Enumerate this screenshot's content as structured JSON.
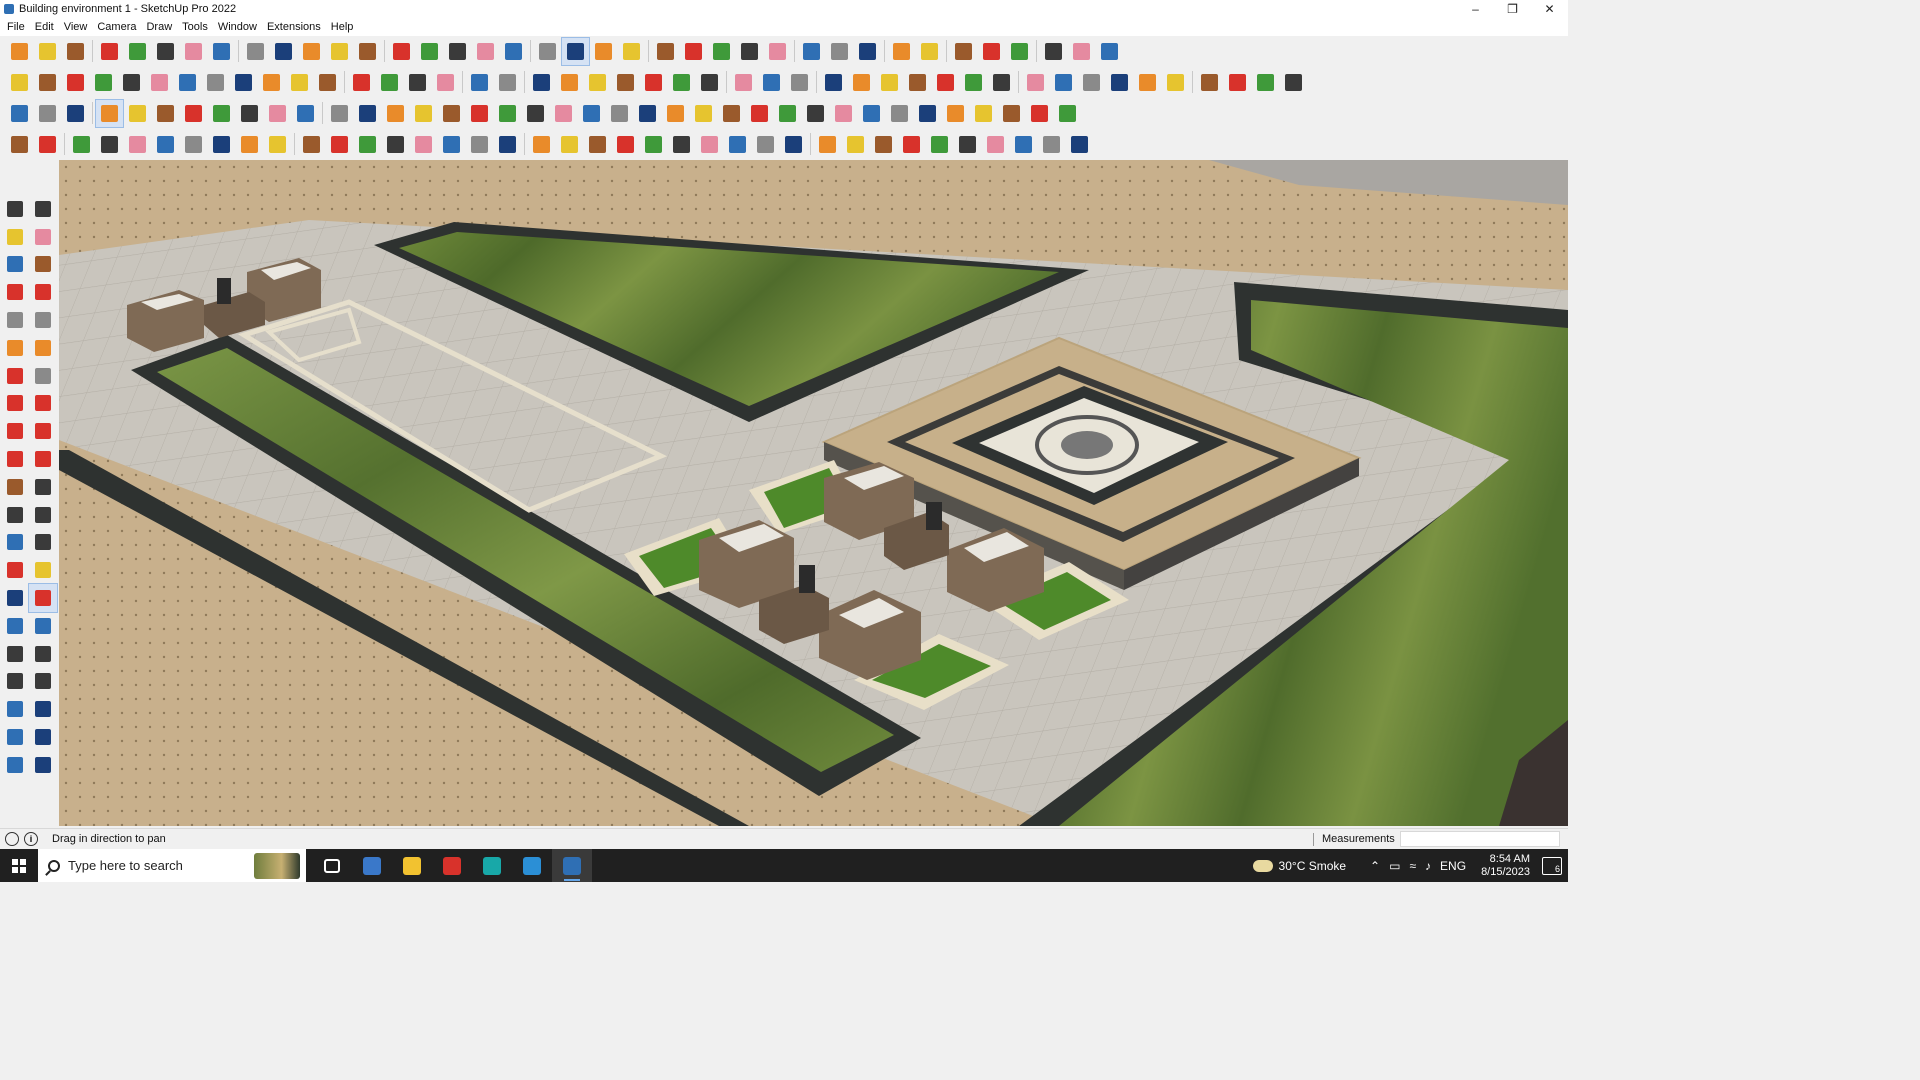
{
  "window": {
    "title": "Building environment 1 - SketchUp Pro 2022",
    "minimize_glyph": "–",
    "maximize_glyph": "❐",
    "close_glyph": "✕"
  },
  "menu": [
    "File",
    "Edit",
    "View",
    "Camera",
    "Draw",
    "Tools",
    "Window",
    "Extensions",
    "Help"
  ],
  "toolbar_colors": {
    "red": "#d8322b",
    "orange": "#e98b2a",
    "blue": "#2f6fb4",
    "navy": "#1b3f7a",
    "green": "#3f9a3a",
    "yellow": "#e6c42f",
    "gray": "#8a8a8a",
    "dark": "#3a3a3a",
    "brown": "#9a5a2c",
    "pink": "#e58aa0"
  },
  "status": {
    "message": "Drag in direction to pan",
    "info_glyph": "i",
    "measurements_label": "Measurements",
    "measurements_value": ""
  },
  "taskbar": {
    "search_placeholder": "Type here to search",
    "weather": "30°C Smoke",
    "language": "ENG",
    "time": "8:54 AM",
    "date": "8/15/2023",
    "notifications": "6",
    "apps": [
      {
        "name": "task-view",
        "color": "#ffffff"
      },
      {
        "name": "calculator",
        "color": "#3a78c9"
      },
      {
        "name": "file-explorer",
        "color": "#f2c230"
      },
      {
        "name": "acrobat",
        "color": "#d8322b"
      },
      {
        "name": "3ds-max",
        "color": "#18a8a8"
      },
      {
        "name": "edge",
        "color": "#2b8fd6"
      },
      {
        "name": "sketchup",
        "color": "#2f6fb4"
      }
    ]
  }
}
